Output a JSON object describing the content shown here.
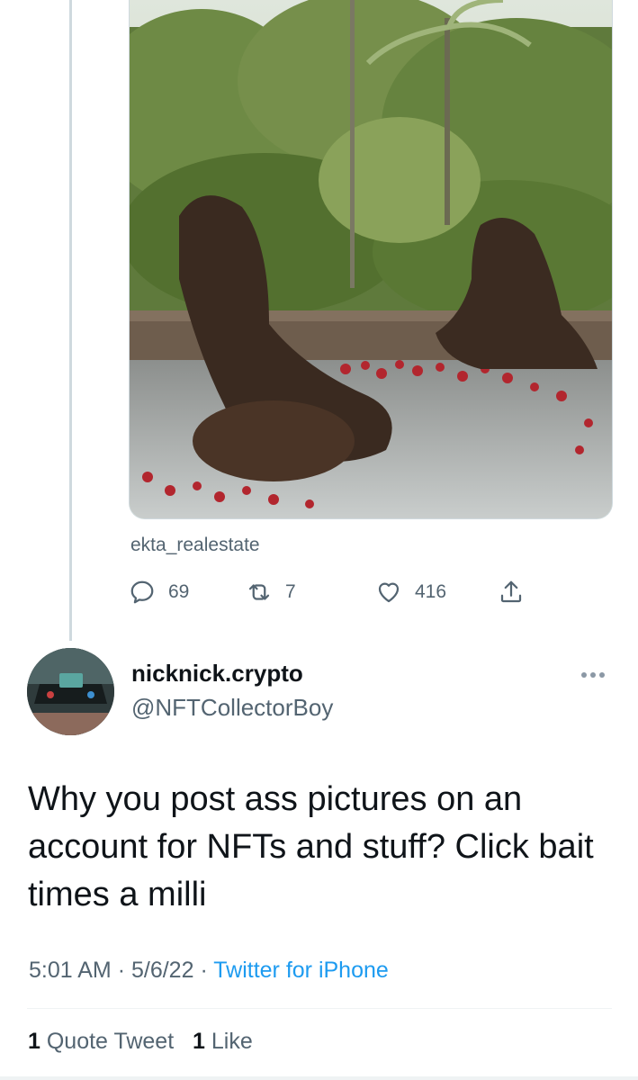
{
  "media": {
    "alt": "photo",
    "source_label": "ekta_realestate"
  },
  "actions": {
    "reply_count": "69",
    "retweet_count": "7",
    "like_count": "416"
  },
  "reply": {
    "display_name": "nicknick.crypto",
    "handle": "@NFTCollectorBoy",
    "text": "Why you post ass pictures on an account for NFTs and stuff? Click bait times a milli",
    "time": "5:01 AM",
    "date": "5/6/22",
    "separator": "·",
    "client": "Twitter for iPhone",
    "quote_count": "1",
    "quote_label": "Quote Tweet",
    "like_count": "1",
    "like_label": "Like"
  },
  "colors": {
    "link": "#1d9bf0",
    "secondary_text": "#536471",
    "primary_text": "#0f1419"
  },
  "icons": [
    "reply-icon",
    "retweet-icon",
    "heart-icon",
    "share-icon",
    "more-options-icon"
  ]
}
